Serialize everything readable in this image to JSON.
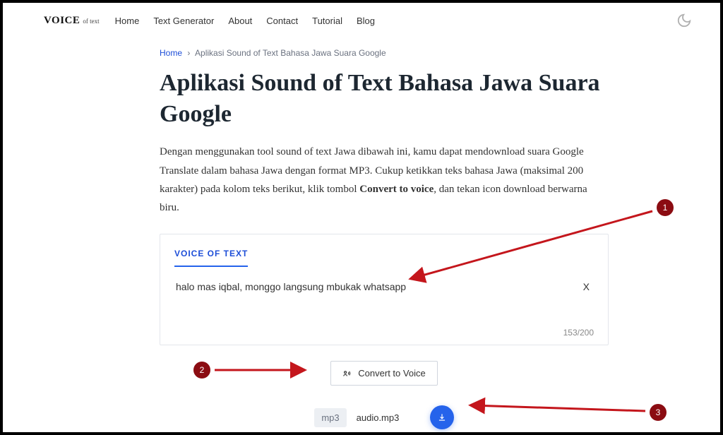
{
  "brand": {
    "main": "VOICE",
    "sub": "of text"
  },
  "nav": {
    "home": "Home",
    "text_generator": "Text Generator",
    "about": "About",
    "contact": "Contact",
    "tutorial": "Tutorial",
    "blog": "Blog"
  },
  "breadcrumb": {
    "home": "Home",
    "sep": "›",
    "current": "Aplikasi Sound of Text Bahasa Jawa Suara Google"
  },
  "page": {
    "title": "Aplikasi Sound of Text Bahasa Jawa Suara Google",
    "intro_a": "Dengan menggunakan tool sound of text Jawa dibawah ini, kamu dapat mendownload suara Google Translate dalam bahasa Jawa dengan format MP3. Cukup ketikkan teks bahasa Jawa (maksimal 200 karakter) pada kolom teks berikut, klik tombol ",
    "intro_b_strong": "Convert to voice",
    "intro_c": ", dan tekan icon download berwarna biru."
  },
  "card": {
    "tab_label": "VOICE OF TEXT",
    "input_value": "halo mas iqbal, monggo langsung mbukak whatsapp",
    "clear_label": "X",
    "counter": "153/200"
  },
  "buttons": {
    "convert": "Convert to Voice"
  },
  "result": {
    "format": "mp3",
    "filename": "audio.mp3"
  },
  "annotations": {
    "one": "1",
    "two": "2",
    "three": "3"
  }
}
